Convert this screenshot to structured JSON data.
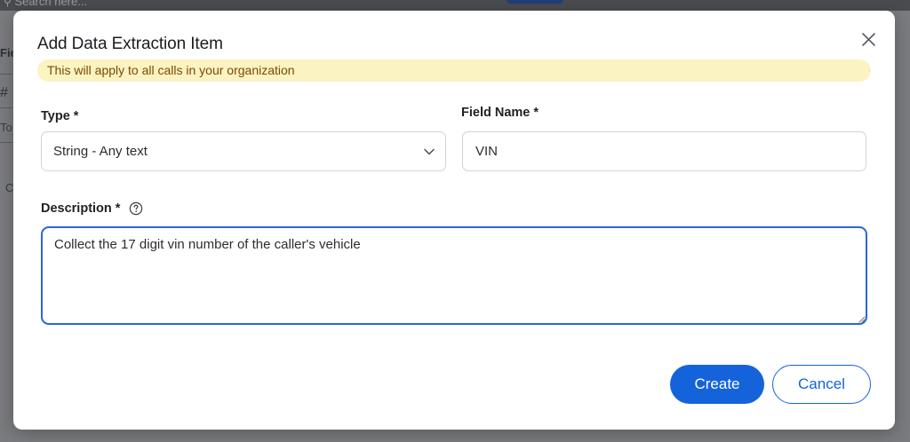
{
  "background": {
    "search_placeholder": "Search here...",
    "fragments": [
      "Fie",
      "#",
      "To",
      "C"
    ]
  },
  "modal": {
    "title": "Add Data Extraction Item",
    "banner_text": "This will apply to all calls in your organization",
    "type": {
      "label": "Type *",
      "selected_value": "String - Any text"
    },
    "field_name": {
      "label": "Field Name *",
      "value": "VIN"
    },
    "description": {
      "label": "Description *",
      "value": "Collect the 17 digit vin number of the caller's vehicle"
    },
    "buttons": {
      "create": "Create",
      "cancel": "Cancel"
    }
  },
  "colors": {
    "accent": "#1463db",
    "banner_bg": "#fbf3c2",
    "banner_text": "#7a4a00",
    "focus_border": "#2f63d8"
  },
  "icons": {
    "close": "close-icon",
    "select_caret": "chevron-down-icon",
    "help": "help-circle-icon"
  }
}
